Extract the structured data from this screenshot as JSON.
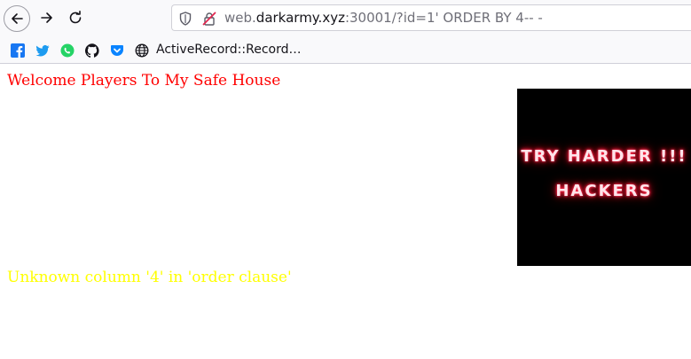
{
  "browser": {
    "url": {
      "prefix": "web.",
      "host": "darkarmy.xyz",
      "suffix": ":30001/?id=1' ORDER BY 4-- -"
    },
    "bookmarks": {
      "icons": [
        "facebook-icon",
        "twitter-icon",
        "whatsapp-icon",
        "github-icon",
        "pocket-icon",
        "globe-icon"
      ],
      "label": "ActiveRecord::Record…"
    }
  },
  "page": {
    "welcome_text": "Welcome Players To My Safe House",
    "banner_line1": "TRY HARDER !!!",
    "banner_line2": "HACKERS",
    "error_text": "Unknown column '4' in 'order clause'"
  },
  "colors": {
    "welcome": "#ff0000",
    "error": "#ffff00",
    "banner_bg": "#000000",
    "neon": "#ff2040"
  }
}
